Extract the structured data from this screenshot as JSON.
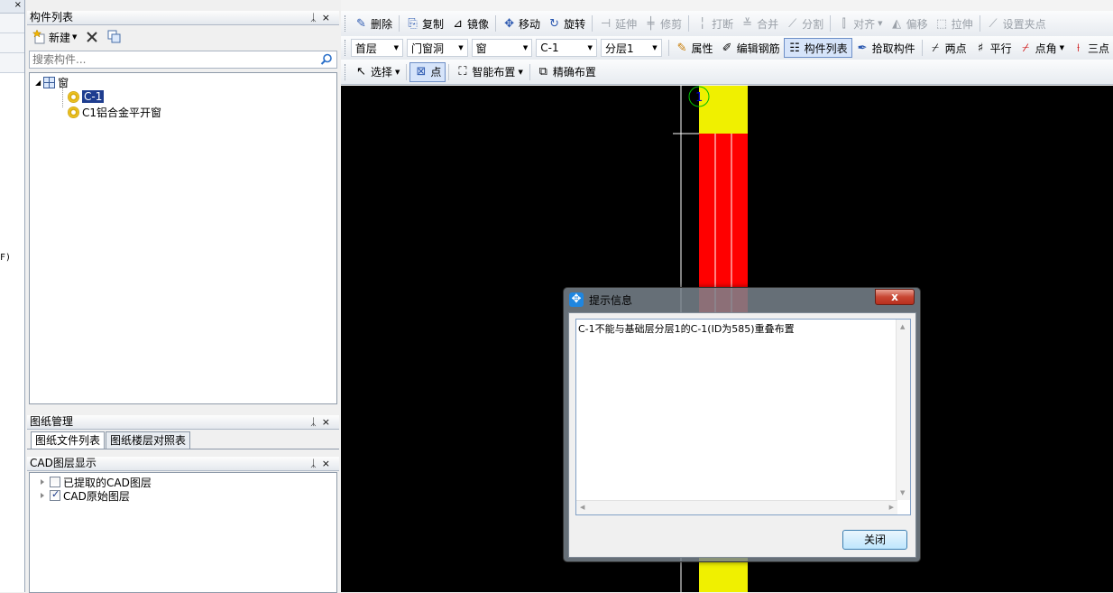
{
  "left_strip": {
    "header_ctrl": "×",
    "fragment": "F)"
  },
  "component_panel": {
    "title": "构件列表",
    "pin": "ᛣ",
    "close": "×",
    "new_label": "新建",
    "search_placeholder": "搜索构件...",
    "tree": {
      "root": "窗",
      "items": [
        {
          "label": "C-1",
          "selected": true
        },
        {
          "label": "C1铝合金平开窗",
          "selected": false
        }
      ]
    }
  },
  "drawing_panel": {
    "title": "图纸管理",
    "tabs": [
      "图纸文件列表",
      "图纸楼层对照表"
    ]
  },
  "cad_panel": {
    "title": "CAD图层显示",
    "layers": [
      {
        "label": "已提取的CAD图层",
        "checked": false
      },
      {
        "label": "CAD原始图层",
        "checked": true
      }
    ]
  },
  "toolbar_edit": {
    "items": [
      {
        "label": "删除",
        "icon": "pencil-eraser-icon",
        "disabled": false
      },
      {
        "label": "复制",
        "icon": "copy-icon",
        "disabled": false
      },
      {
        "label": "镜像",
        "icon": "mirror-icon",
        "disabled": false
      },
      {
        "label": "移动",
        "icon": "move-icon",
        "disabled": false
      },
      {
        "label": "旋转",
        "icon": "rotate-icon",
        "disabled": false
      },
      {
        "label": "延伸",
        "icon": "extend-icon",
        "disabled": true
      },
      {
        "label": "修剪",
        "icon": "trim-icon",
        "disabled": true
      },
      {
        "label": "打断",
        "icon": "break-icon",
        "disabled": true
      },
      {
        "label": "合并",
        "icon": "merge-icon",
        "disabled": true
      },
      {
        "label": "分割",
        "icon": "split-icon",
        "disabled": true
      },
      {
        "label": "对齐",
        "icon": "align-icon",
        "disabled": true
      },
      {
        "label": "偏移",
        "icon": "offset-icon",
        "disabled": true
      },
      {
        "label": "拉伸",
        "icon": "stretch-icon",
        "disabled": true
      },
      {
        "label": "设置夹点",
        "icon": "grip-icon",
        "disabled": true
      }
    ]
  },
  "toolbar_filter": {
    "combos": [
      "首层",
      "门窗洞",
      "窗",
      "C-1",
      "分层1"
    ],
    "items": [
      {
        "label": "属性",
        "icon": "properties-icon"
      },
      {
        "label": "编辑钢筋",
        "icon": "edit-rebar-icon"
      },
      {
        "label": "构件列表",
        "icon": "component-list-icon",
        "pressed": true
      },
      {
        "label": "拾取构件",
        "icon": "pick-icon"
      },
      {
        "label": "两点",
        "icon": "two-point-icon"
      },
      {
        "label": "平行",
        "icon": "parallel-icon"
      },
      {
        "label": "点角",
        "icon": "point-angle-icon"
      },
      {
        "label": "三点",
        "icon": "three-point-icon"
      }
    ]
  },
  "toolbar_draw": {
    "select_label": "选择",
    "point_label": "点",
    "smart_label": "智能布置",
    "precise_label": "精确布置"
  },
  "canvas": {
    "axis_label": "1",
    "colors": {
      "background": "#000000",
      "wall": "#f0f000",
      "window": "#ff0000",
      "axis": "#00ff00"
    }
  },
  "dialog": {
    "title": "提示信息",
    "close_x": "x",
    "message": "C-1不能与基础层分层1的C-1(ID为585)重叠布置",
    "close_button": "关闭"
  }
}
